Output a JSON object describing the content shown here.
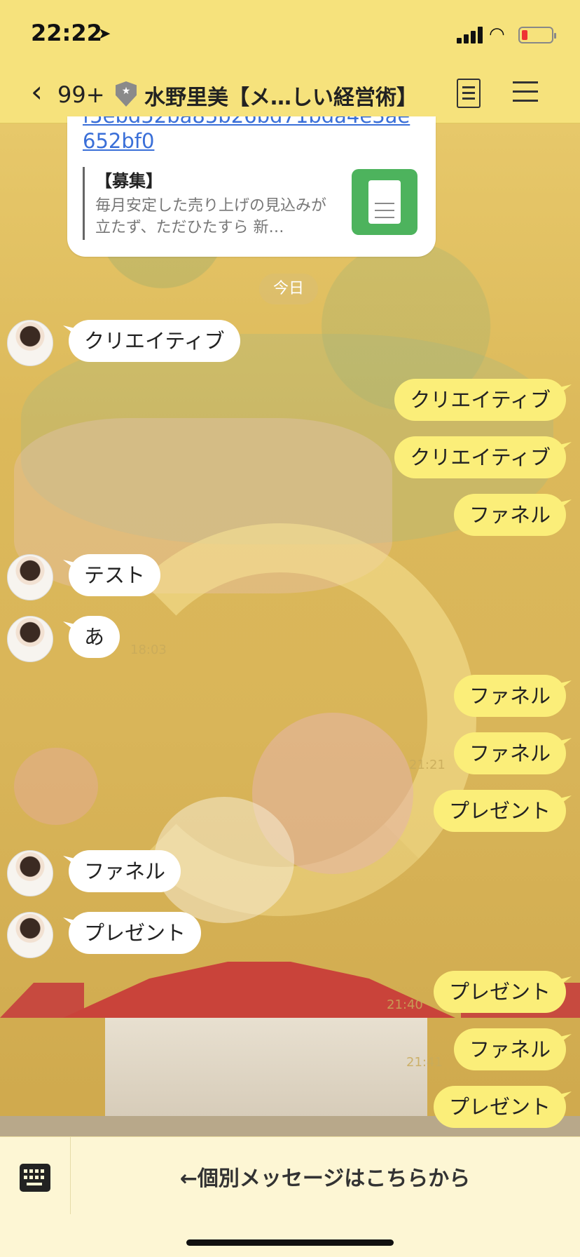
{
  "status": {
    "time": "22:22"
  },
  "header": {
    "back_count": "99+",
    "title": "水野里美【メ…しい経営術】"
  },
  "card": {
    "link_prev": "f5ebd52ba85b26bd71bda4e3ae",
    "link": "652bf0",
    "quote_title": "【募集】",
    "quote_text": "毎月安定した売り上げの見込みが立たず、ただひたすら 新…"
  },
  "date_label": "今日",
  "messages": [
    {
      "side": "left",
      "text": "クリエイティブ"
    },
    {
      "side": "right",
      "text": "クリエイティブ"
    },
    {
      "side": "right",
      "text": "クリエイティブ"
    },
    {
      "side": "right",
      "text": "ファネル"
    },
    {
      "side": "left",
      "text": "テスト"
    },
    {
      "side": "left",
      "text": "あ",
      "time": "18:03"
    },
    {
      "side": "right",
      "text": "ファネル"
    },
    {
      "side": "right",
      "text": "ファネル",
      "time": "21:21"
    },
    {
      "side": "right",
      "text": "プレゼント"
    },
    {
      "side": "left",
      "text": "ファネル"
    },
    {
      "side": "left",
      "text": "プレゼント"
    },
    {
      "side": "right",
      "text": "プレゼント",
      "time": "21:40"
    },
    {
      "side": "right",
      "text": "ファネル",
      "time": "21:41"
    },
    {
      "side": "right",
      "text": "プレゼント"
    }
  ],
  "bottom": {
    "text": "←個別メッセージはこちらから"
  },
  "colors": {
    "header_bg": "#f6e27c",
    "right_bubble": "#fbee79",
    "left_bubble": "#ffffff",
    "link": "#3a6fd8"
  }
}
